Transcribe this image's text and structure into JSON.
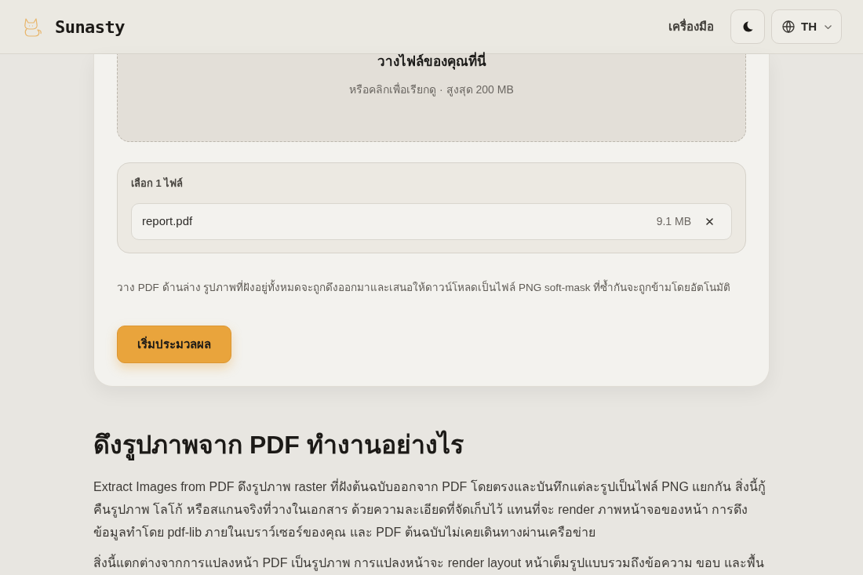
{
  "header": {
    "brand": "Sunasty",
    "nav_link": "เครื่องมือ",
    "language": {
      "code": "TH"
    }
  },
  "dropzone": {
    "title": "วางไฟล์ของคุณที่นี่",
    "hint": "หรือคลิกเพื่อเรียกดู · สูงสุด 200 MB"
  },
  "selected_files": {
    "label": "เลือก 1 ไฟล์",
    "files": [
      {
        "name": "report.pdf",
        "size": "9.1 MB"
      }
    ]
  },
  "description": "วาง PDF ด้านล่าง รูปภาพที่ฝังอยู่ทั้งหมดจะถูกดึงออกมาและเสนอให้ดาวน์โหลดเป็นไฟล์ PNG soft-mask ที่ซ้ำกันจะถูกข้ามโดยอัตโนมัติ",
  "start_button": "เริ่มประมวลผล",
  "article": {
    "heading": "ดึงรูปภาพจาก PDF ทำงานอย่างไร",
    "paragraphs": [
      "Extract Images from PDF ดึงรูปภาพ raster ที่ฝังต้นฉบับออกจาก PDF โดยตรงและบันทึกแต่ละรูปเป็นไฟล์ PNG แยกกัน สิ่งนี้กู้คืนรูปภาพ โลโก้ หรือสแกนจริงที่วางในเอกสาร ด้วยความละเอียดที่จัดเก็บไว้ แทนที่จะ render ภาพหน้าจอของหน้า การดึงข้อมูลทำโดย pdf-lib ภายในเบราว์เซอร์ของคุณ และ PDF ต้นฉบับไม่เคยเดินทางผ่านเครือข่าย",
      "สิ่งนี้แตกต่างจากการแปลงหน้า PDF เป็นรูปภาพ การแปลงหน้าจะ render layout หน้าเต็มรูปแบบรวมถึงข้อความ ขอบ และพื้น"
    ]
  }
}
